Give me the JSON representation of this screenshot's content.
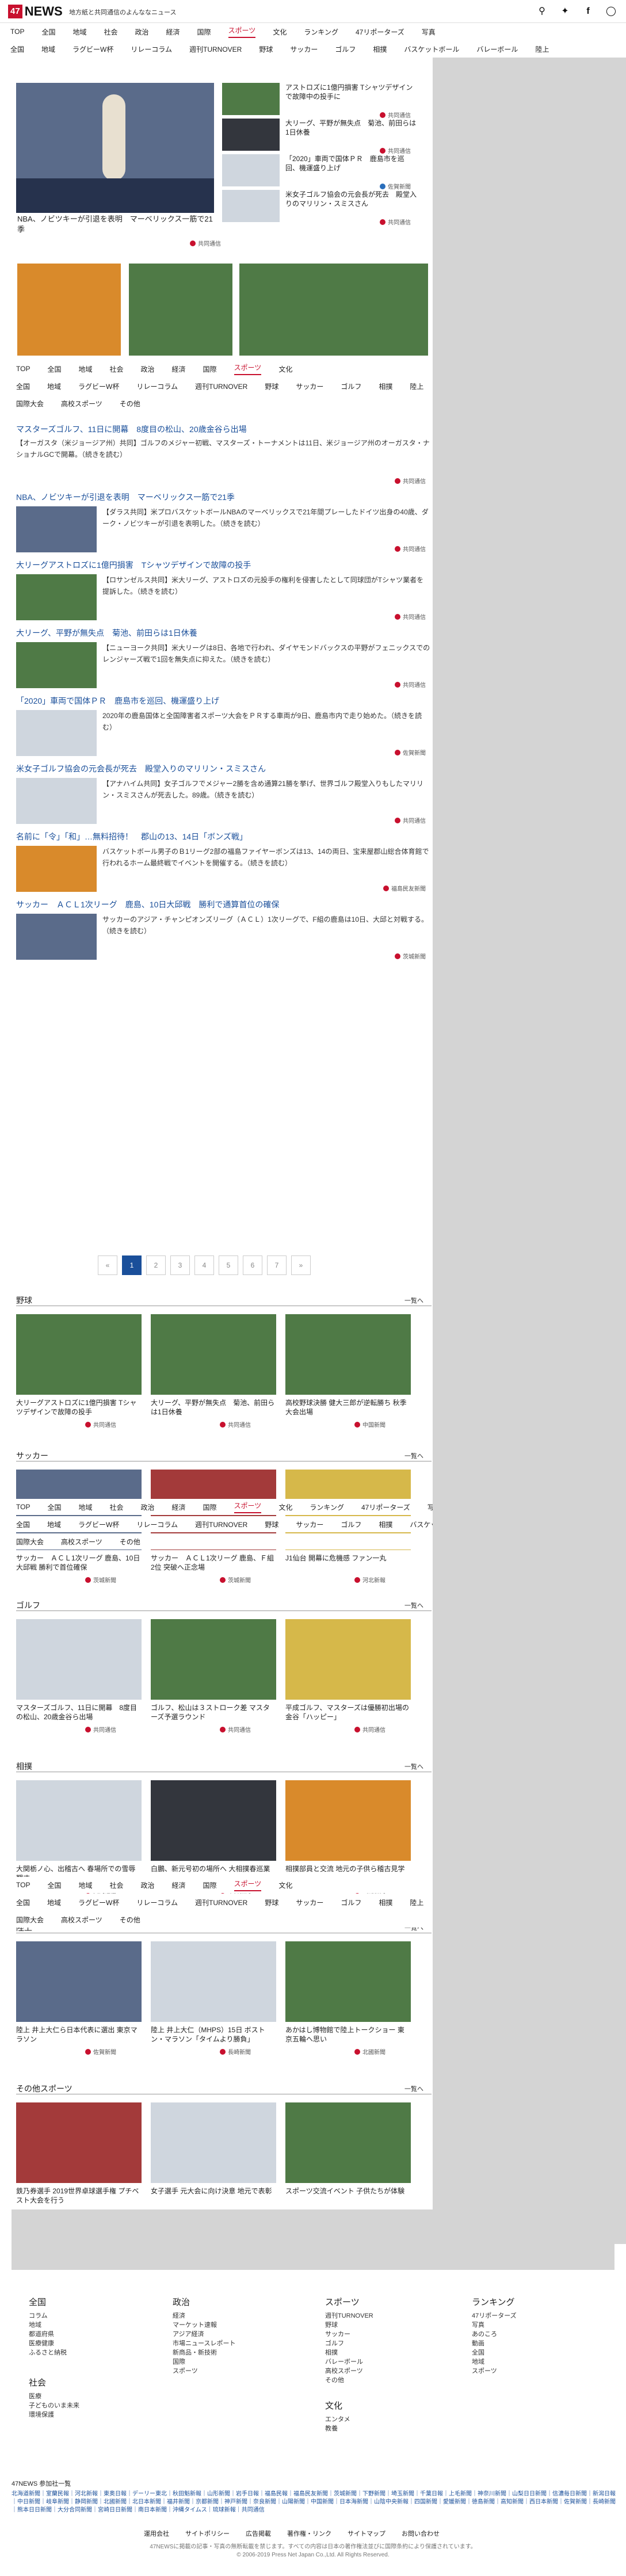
{
  "header": {
    "logo_box": "47",
    "logo_text": "NEWS",
    "tagline": "地方紙と共同通信のよんななニュース",
    "icons": [
      "search-icon",
      "twitter-icon",
      "facebook-icon",
      "language-icon"
    ]
  },
  "nav_main": [
    "TOP",
    "全国",
    "地域",
    "社会",
    "政治",
    "経済",
    "国際",
    "スポーツ",
    "文化",
    "ランキング",
    "47リポーターズ",
    "写真"
  ],
  "nav_sub": [
    "全国",
    "地域",
    "ラグビーW杯",
    "リレーコラム",
    "週刊TURNOVER",
    "野球",
    "サッカー",
    "ゴルフ",
    "相撲",
    "バスケットボール",
    "バレーボール",
    "陸上"
  ],
  "nav_sub2": [
    "国際大会",
    "高校スポーツ",
    "その他"
  ],
  "nav_main_short": [
    "TOP",
    "全国",
    "地域",
    "社会",
    "政治",
    "経済",
    "国際",
    "スポーツ",
    "文化"
  ],
  "nav_sub_short": [
    "全国",
    "地域",
    "ラグビーW杯",
    "リレーコラム",
    "週刊TURNOVER",
    "野球",
    "サッカー",
    "ゴルフ",
    "相撲",
    "陸上"
  ],
  "hero": {
    "caption": "NBA、ノビツキーが引退を表明　マーベリックス一筋で21季",
    "source": "共同通信"
  },
  "top_right": [
    {
      "caption": "アストロズに1億円損害 Tシャツデザインで故障中の投手に",
      "source": "共同通信"
    },
    {
      "caption": "大リーグ、平野が無失点　菊池、前田らは1日休養",
      "source": "共同通信"
    },
    {
      "caption": "「2020」車両で国体ＰＲ　鹿島市を巡回、機運盛り上げ",
      "source": "佐賀新聞"
    },
    {
      "caption": "米女子ゴルフ協会の元会長が死去　殿堂入りのマリリン・スミスさん",
      "source": "共同通信"
    }
  ],
  "list": [
    {
      "title": "マスターズゴルフ、11日に開幕　8度目の松山、20歳金谷ら出場",
      "body": "【オーガスタ（米ジョージア州）共同】ゴルフのメジャー初戦、マスターズ・トーナメントは11日、米ジョージア州のオーガスタ・ナショナルGCで開幕。（続きを読む）",
      "source": "共同通信"
    },
    {
      "title": "NBA、ノビツキーが引退を表明　マーベリックス一筋で21季",
      "body": "【ダラス共同】米プロバスケットボールNBAのマーベリックスで21年間プレーしたドイツ出身の40歳、ダーク・ノビツキーが引退を表明した。（続きを読む）",
      "source": "共同通信"
    },
    {
      "title": "大リーグアストロズに1億円損害　Tシャツデザインで故障の投手",
      "body": "【ロサンゼルス共同】米大リーグ、アストロズの元投手の権利を侵害したとして同球団がTシャツ業者を提訴した。（続きを読む）",
      "source": "共同通信"
    },
    {
      "title": "大リーグ、平野が無失点　菊池、前田らは1日休養",
      "body": "【ニューヨーク共同】米大リーグは8日、各地で行われ、ダイヤモンドバックスの平野がフェニックスでのレンジャーズ戦で1回を無失点に抑えた。（続きを読む）",
      "source": "共同通信"
    },
    {
      "title": "「2020」車両で国体ＰＲ　鹿島市を巡回、機運盛り上げ",
      "body": "2020年の鹿島国体と全国障害者スポーツ大会をＰＲする車両が9日、鹿島市内で走り始めた。（続きを読む）",
      "source": "佐賀新聞"
    },
    {
      "title": "米女子ゴルフ協会の元会長が死去　殿堂入りのマリリン・スミスさん",
      "body": "【アナハイム共同】女子ゴルフでメジャー2勝を含め通算21勝を挙げ、世界ゴルフ殿堂入りもしたマリリン・スミスさんが死去した。89歳。（続きを読む）",
      "source": "共同通信"
    },
    {
      "title": "名前に「令」「和」…無料招待！　郡山の13、14日「ボンズ戦」",
      "body": "バスケットボール男子のＢ1リーグ2部の福島ファイヤーボンズは13、14の両日、宝来屋郡山総合体育館で行われるホーム最終戦でイベントを開催する。（続きを読む）",
      "source": "福島民友新聞"
    },
    {
      "title": "サッカー　ＡＣＬ1次リーグ　鹿島、10日大邱戦　勝利で通算首位の確保",
      "body": "サッカーのアジア・チャンピオンズリーグ（ＡＣＬ）1次リーグで、F組の鹿島は10日、大邱と対戦する。（続きを読む）",
      "source": "茨城新聞"
    }
  ],
  "pager": [
    "«",
    "1",
    "2",
    "3",
    "4",
    "5",
    "6",
    "7",
    "»"
  ],
  "sections": [
    {
      "name": "野球",
      "more": "一覧へ",
      "items": [
        {
          "caption": "大リーグアストロズに1億円損害 Tシャツデザインで故障の投手",
          "source": "共同通信"
        },
        {
          "caption": "大リーグ、平野が無失点　菊池、前田らは1日休養",
          "source": "共同通信"
        },
        {
          "caption": "高校野球決勝 健大三郎が逆転勝ち 秋季大会出場",
          "source": "中国新聞"
        }
      ]
    },
    {
      "name": "サッカー",
      "more": "一覧へ",
      "items": [
        {
          "caption": "サッカー　ＡＣＬ1次リーグ 鹿島、10日大邱戦 勝利で首位確保",
          "source": "茨城新聞"
        },
        {
          "caption": "サッカー　ＡＣＬ1次リーグ 鹿島、Ｆ組2位 突破へ正念場",
          "source": "茨城新聞"
        },
        {
          "caption": "J1仙台 開幕に危機感 ファン一丸",
          "source": "河北新報"
        }
      ]
    },
    {
      "name": "ゴルフ",
      "more": "一覧へ",
      "items": [
        {
          "caption": "マスターズゴルフ、11日に開幕　8度目の松山、20歳金谷ら出場",
          "source": "共同通信"
        },
        {
          "caption": "ゴルフ、松山は３ストローク差 マスターズ予選ラウンド",
          "source": "共同通信"
        },
        {
          "caption": "平成ゴルフ、マスターズは優勝初出場の金谷「ハッピー」",
          "source": "共同通信"
        }
      ]
    },
    {
      "name": "相撲",
      "more": "一覧へ",
      "items": [
        {
          "caption": "大関栃ノ心、出稽古へ 春場所での雪辱期す",
          "source": "共同通信"
        },
        {
          "caption": "白鵬、新元号初の場所へ 大相撲春巡業",
          "source": "中日新聞"
        },
        {
          "caption": "相撲部員と交流 地元の子供ら稽古見学",
          "source": "山陽新聞"
        }
      ]
    },
    {
      "name": "陸上",
      "more": "一覧へ",
      "items": [
        {
          "caption": "陸上 井上大仁ら日本代表に選出 東京マラソン",
          "source": "佐賀新聞"
        },
        {
          "caption": "陸上 井上大仁（MHPS）15日 ボストン・マラソン「タイムより勝負」",
          "source": "長崎新聞"
        },
        {
          "caption": "あかはし博物館で陸上トークショー 東京五輪へ思い",
          "source": "北國新聞"
        }
      ]
    },
    {
      "name": "その他スポーツ",
      "more": "一覧へ",
      "items": [
        {
          "caption": "鉄乃券選手 2019世界卓球選手権 プチベスト大会を行う",
          "source": "共同通信"
        },
        {
          "caption": "女子選手 元大会に向け決意 地元で表彰",
          "source": "共同通信"
        },
        {
          "caption": "スポーツ交流イベント 子供たちが体験",
          "source": "共同通信"
        }
      ]
    }
  ],
  "footer": {
    "cols": [
      {
        "head": "全国",
        "subs": [
          "コラム",
          "地域",
          "都道府県",
          "医療健康",
          "ふるさと納税"
        ]
      },
      {
        "head": "政治",
        "subs": [
          "経済",
          "マーケット速報",
          "アジア経済",
          "市場ニュースレポート",
          "新商品・新技術",
          "国際",
          "スポーツ"
        ]
      },
      {
        "head": "スポーツ",
        "subs": [
          "週刊TURNOVER",
          "野球",
          "サッカー",
          "ゴルフ",
          "相撲",
          "バレーボール",
          "高校スポーツ",
          "その他"
        ]
      },
      {
        "head": "ランキング",
        "subs": [
          "47リポーターズ",
          "写真",
          "あのころ",
          "動画",
          "全国",
          "地域",
          "スポーツ"
        ]
      }
    ],
    "col2_extra": {
      "head": "社会",
      "subs": [
        "医療",
        "子どものいま未来",
        "環境保護"
      ]
    },
    "col3_extra": {
      "head": "文化",
      "subs": [
        "エンタメ",
        "教養"
      ]
    },
    "partners_head": "47NEWS 参加社一覧",
    "partners": "北海道新聞｜室蘭民報｜河北新報｜東奥日報｜デーリー東北｜秋田魁新報｜山形新聞｜岩手日報｜福島民報｜福島民友新聞｜茨城新聞｜下野新聞｜埼玉新聞｜千葉日報｜上毛新聞｜神奈川新聞｜山梨日日新聞｜信濃毎日新聞｜新潟日報｜中日新聞｜岐阜新聞｜静岡新聞｜北國新聞｜北日本新聞｜福井新聞｜京都新聞｜神戸新聞｜奈良新聞｜山陽新聞｜中国新聞｜日本海新聞｜山陰中央新報｜四国新聞｜愛媛新聞｜徳島新聞｜高知新聞｜西日本新聞｜佐賀新聞｜長崎新聞｜熊本日日新聞｜大分合同新聞｜宮崎日日新聞｜南日本新聞｜沖縄タイムス｜琉球新報｜共同通信",
    "links": [
      "運用会社",
      "サイトポリシー",
      "広告掲載",
      "著作権・リンク",
      "サイトマップ",
      "お問い合わせ"
    ],
    "copy1": "47NEWSに掲載の記事・写真の無断転載を禁じます。すべての内容は日本の著作権法並びに国際条約により保護されています。",
    "copy2": "© 2006-2019 Press Net Japan Co.,Ltd. All Rights Reserved."
  }
}
